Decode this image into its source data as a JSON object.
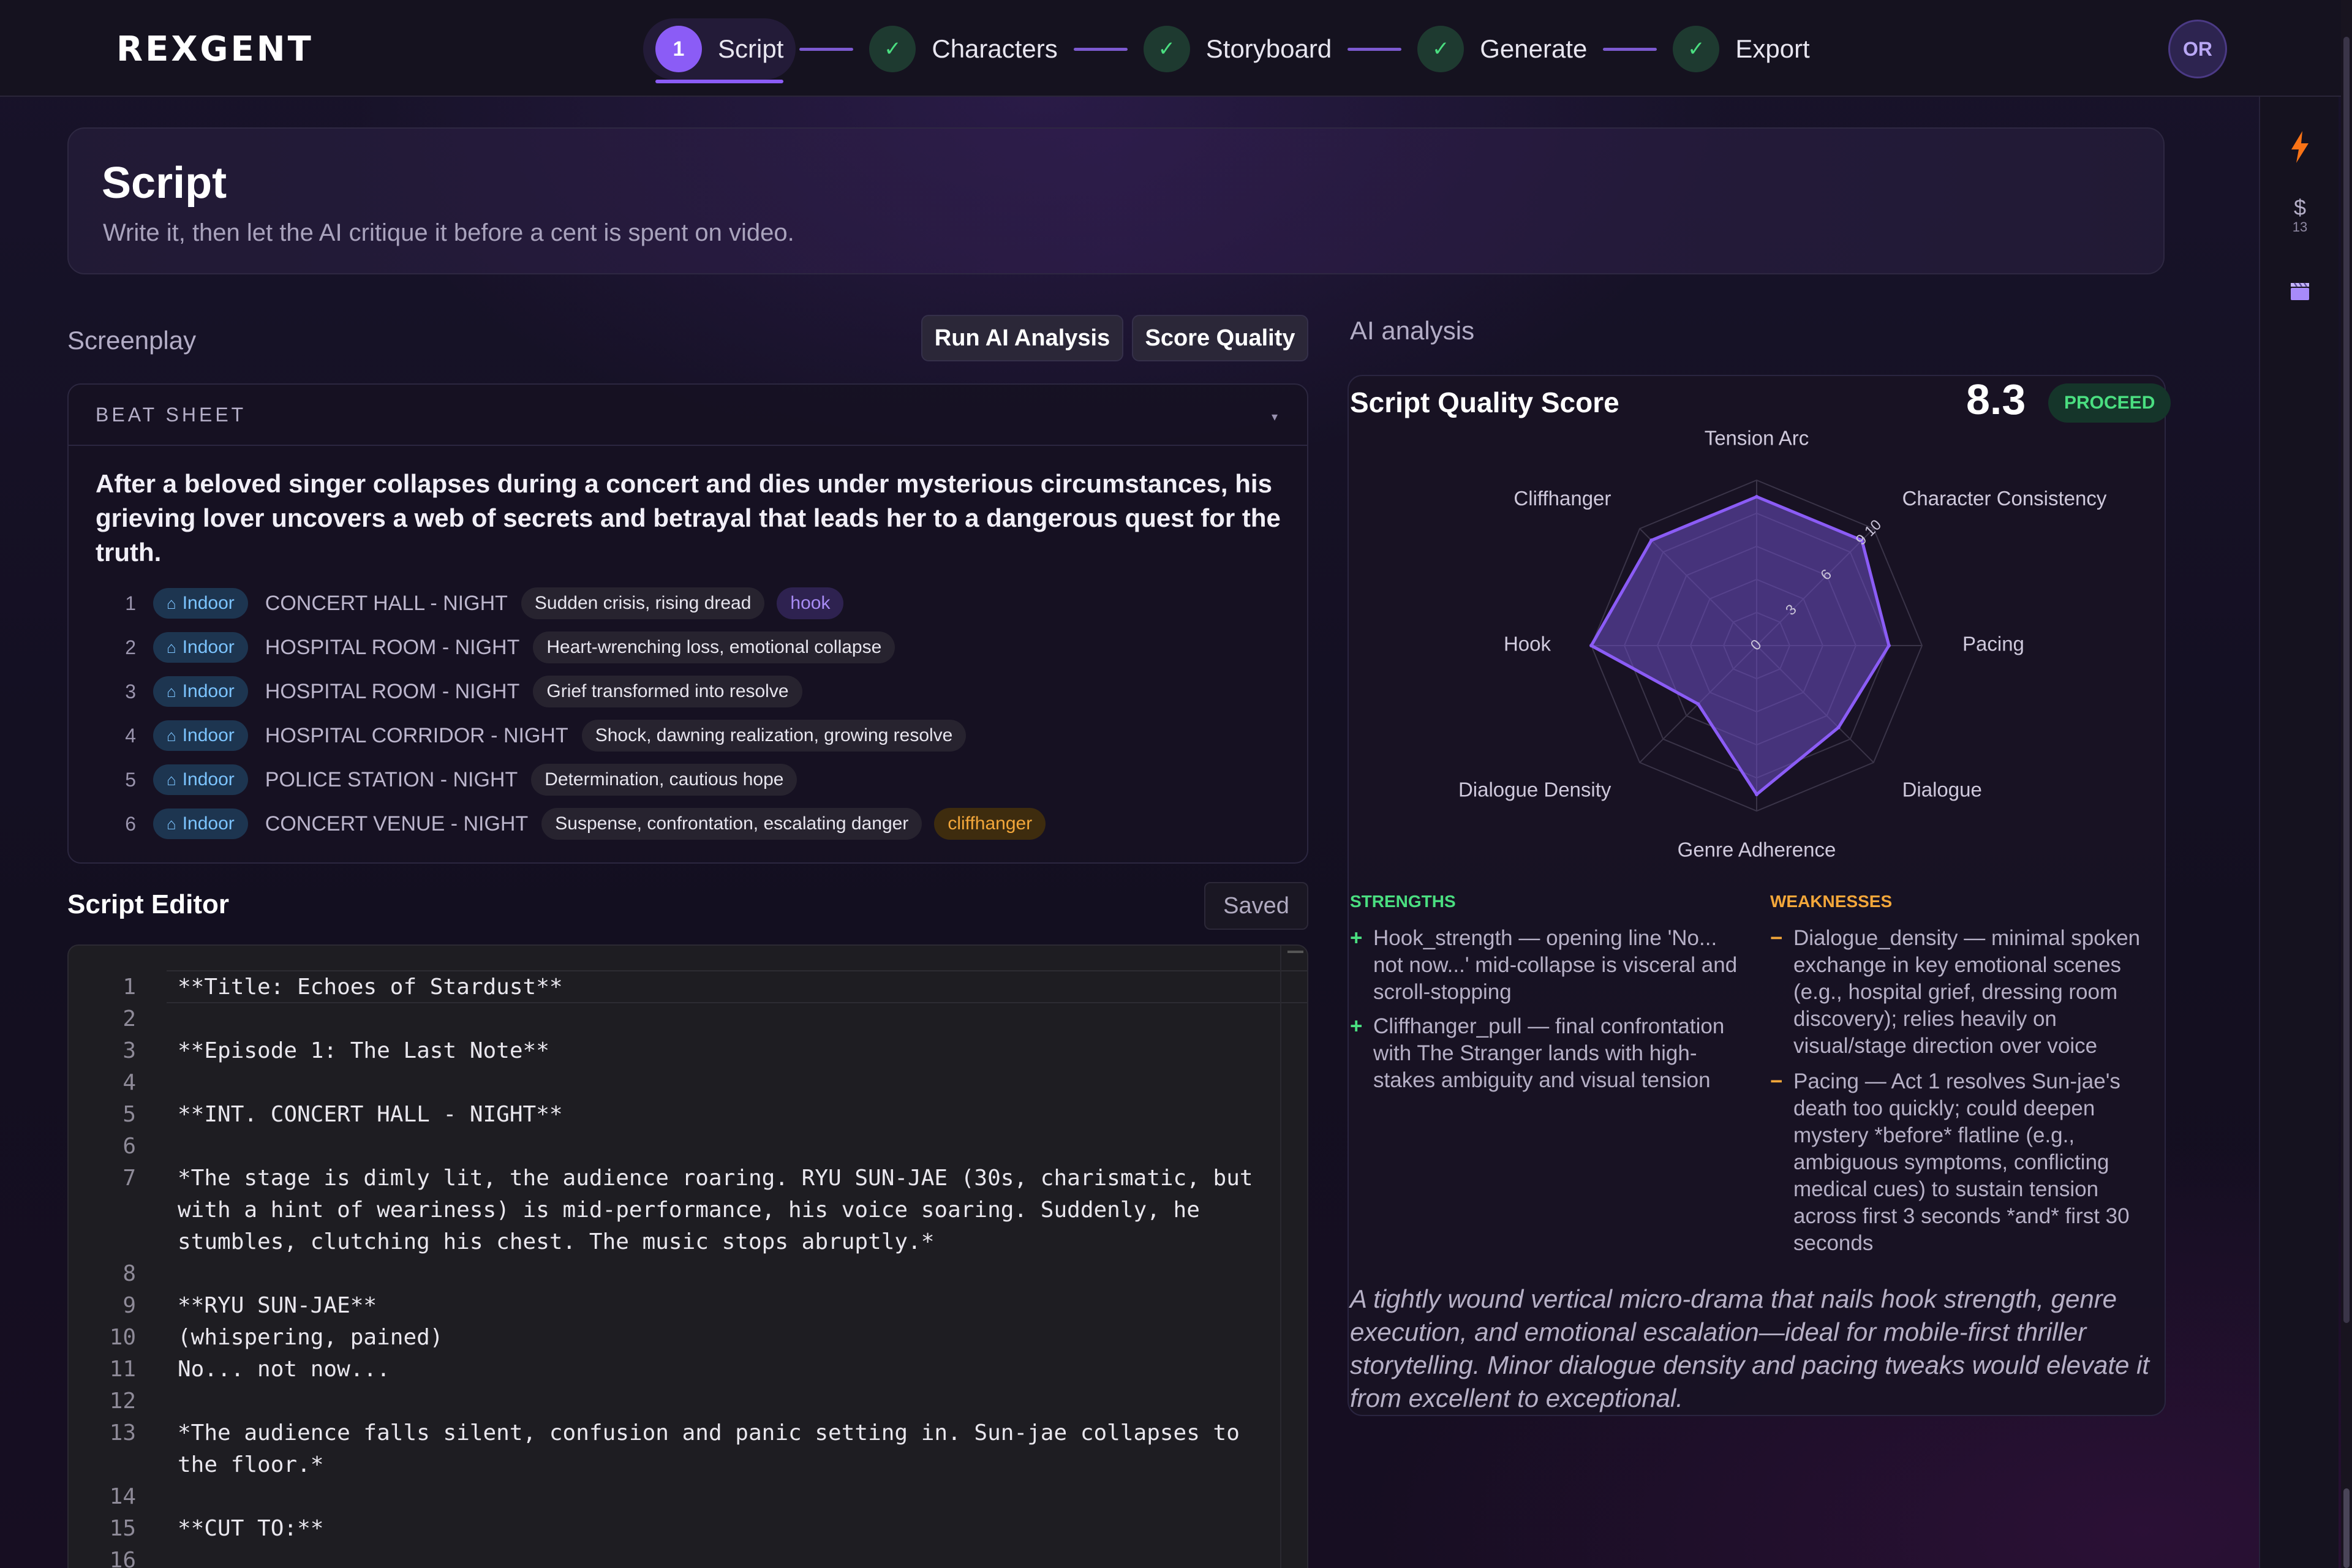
{
  "app": {
    "logo": "REXGENT"
  },
  "stepper": {
    "steps": [
      {
        "label": "Script",
        "number": "1",
        "state": "active"
      },
      {
        "label": "Characters",
        "state": "done"
      },
      {
        "label": "Storyboard",
        "state": "done"
      },
      {
        "label": "Generate",
        "state": "done"
      },
      {
        "label": "Export",
        "state": "done"
      }
    ]
  },
  "user": {
    "initials": "OR"
  },
  "rail": {
    "dollar": "$",
    "credits": "13",
    "icons": [
      "lightning-icon",
      "dollar-icon",
      "clapperboard-icon"
    ]
  },
  "header": {
    "title": "Script",
    "subtitle": "Write it, then let the AI critique it before a cent is spent on video."
  },
  "screenplay": {
    "label": "Screenplay",
    "run_analysis": "Run AI Analysis",
    "score_quality": "Score Quality"
  },
  "beat_sheet": {
    "title": "BEAT SHEET",
    "logline": "After a beloved singer collapses during a concert and dies under mysterious circumstances, his grieving lover uncovers a web of secrets and betrayal that leads her to a dangerous quest for the truth.",
    "beats": [
      {
        "n": "1",
        "setting": "Indoor",
        "location": "CONCERT HALL - NIGHT",
        "mood": "Sudden crisis, rising dread",
        "tag": "hook"
      },
      {
        "n": "2",
        "setting": "Indoor",
        "location": "HOSPITAL ROOM - NIGHT",
        "mood": "Heart-wrenching loss, emotional collapse",
        "tag": ""
      },
      {
        "n": "3",
        "setting": "Indoor",
        "location": "HOSPITAL ROOM - NIGHT",
        "mood": "Grief transformed into resolve",
        "tag": ""
      },
      {
        "n": "4",
        "setting": "Indoor",
        "location": "HOSPITAL CORRIDOR - NIGHT",
        "mood": "Shock, dawning realization, growing resolve",
        "tag": ""
      },
      {
        "n": "5",
        "setting": "Indoor",
        "location": "POLICE STATION - NIGHT",
        "mood": "Determination, cautious hope",
        "tag": ""
      },
      {
        "n": "6",
        "setting": "Indoor",
        "location": "CONCERT VENUE - NIGHT",
        "mood": "Suspense, confrontation, escalating danger",
        "tag": "cliffhanger"
      }
    ]
  },
  "editor": {
    "title": "Script Editor",
    "status": "Saved",
    "lines": [
      {
        "n": "1",
        "text": "**Title: Echoes of Stardust**"
      },
      {
        "n": "2",
        "text": ""
      },
      {
        "n": "3",
        "text": "**Episode 1: The Last Note**"
      },
      {
        "n": "4",
        "text": ""
      },
      {
        "n": "5",
        "text": "**INT. CONCERT HALL - NIGHT**"
      },
      {
        "n": "6",
        "text": ""
      },
      {
        "n": "7",
        "text": "*The stage is dimly lit, the audience roaring. RYU SUN-JAE (30s, charismatic, but with a hint of weariness) is mid-performance, his voice soaring. Suddenly, he stumbles, clutching his chest. The music stops abruptly.*"
      },
      {
        "n": "8",
        "text": ""
      },
      {
        "n": "9",
        "text": "**RYU SUN-JAE**"
      },
      {
        "n": "10",
        "text": "(whispering, pained)"
      },
      {
        "n": "11",
        "text": "No... not now..."
      },
      {
        "n": "12",
        "text": ""
      },
      {
        "n": "13",
        "text": "*The audience falls silent, confusion and panic setting in. Sun-jae collapses to the floor.*"
      },
      {
        "n": "14",
        "text": ""
      },
      {
        "n": "15",
        "text": "**CUT TO:**"
      },
      {
        "n": "16",
        "text": ""
      }
    ]
  },
  "analysis": {
    "label": "AI analysis",
    "score_title": "Script Quality Score",
    "score": "8.3",
    "verdict": "PROCEED",
    "strengths_title": "STRENGTHS",
    "weaknesses_title": "WEAKNESSES",
    "strengths": [
      "Hook_strength — opening line 'No... not now...' mid-collapse is visceral and scroll-stopping",
      "Cliffhanger_pull — final confrontation with The Stranger lands with high-stakes ambiguity and visual tension"
    ],
    "weaknesses": [
      "Dialogue_density — minimal spoken exchange in key emotional scenes (e.g., hospital grief, dressing room discovery); relies heavily on visual/stage direction over voice",
      "Pacing — Act 1 resolves Sun-jae's death too quickly; could deepen mystery *before* flatline (e.g., ambiguous symptoms, conflicting medical cues) to sustain tension across first 3 seconds *and* first 30 seconds"
    ],
    "summary": "A tightly wound vertical micro-drama that nails hook strength, genre execution, and emotional escalation—ideal for mobile-first thriller storytelling. Minor dialogue density and pacing tweaks would elevate it from excellent to exceptional."
  },
  "chart_data": {
    "type": "radar",
    "categories": [
      "Tension Arc",
      "Character Consistency",
      "Pacing",
      "Dialogue",
      "Genre Adherence",
      "Dialogue Density",
      "Hook",
      "Cliffhanger"
    ],
    "values": [
      9,
      9,
      8,
      7,
      9,
      5,
      10,
      9
    ],
    "ticks": [
      "0",
      "3",
      "6",
      "9",
      "10"
    ],
    "range": [
      0,
      10
    ],
    "colors": {
      "fill": "#6d4fc4",
      "stroke": "#8b5cf6",
      "grid": "#3a3448"
    }
  },
  "colors": {
    "accent": "#8b5cf6",
    "success": "#4ade80",
    "warning": "#f3a73a"
  }
}
